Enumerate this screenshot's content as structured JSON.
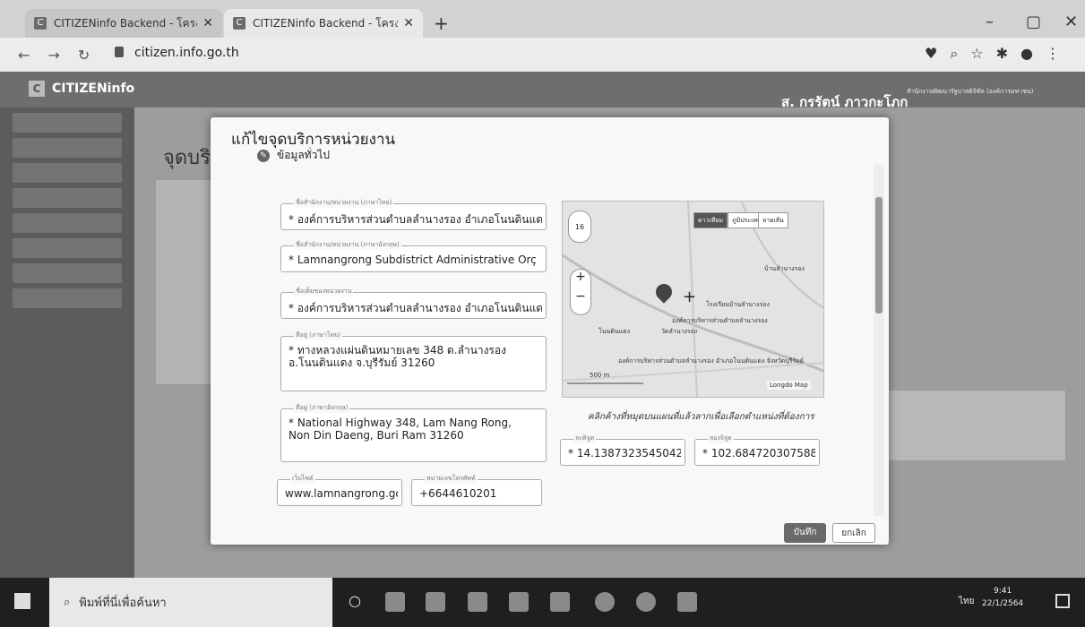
{
  "browser": {
    "tabs": [
      {
        "title": "CITIZENinfo Backend - โครงการฯ"
      },
      {
        "title": "CITIZENinfo Backend - โครงการฯ"
      }
    ],
    "new_tab": "+",
    "url": "citizen.info.go.th",
    "window_controls": [
      "–",
      "▢",
      "✕"
    ]
  },
  "app": {
    "brand": "CITIZENinfo",
    "user_name": "ส. กรรัตน์ ภาวกะโภก",
    "user_sub": "สำนักงานพัฒนารัฐบาลดิจิทัล (องค์การมหาชน)",
    "page_title": "จุดบริ"
  },
  "modal": {
    "title": "แก้ไขจุดบริการหน่วยงาน",
    "section": "ข้อมูลทั่วไป",
    "fields": {
      "name_th": {
        "label": "ชื่อสำนักงาน/หน่วยงาน (ภาษาไทย)",
        "value": "* องค์การบริหารส่วนตำบลลำนางรอง อำเภอโนนดินแด"
      },
      "name_en": {
        "label": "ชื่อสำนักงาน/หน่วยงาน (ภาษาอังกฤษ)",
        "value": "* Lamnangrong Subdistrict Administrative Orç"
      },
      "org_name": {
        "label": "ชื่อเต็มของหน่วยงาน",
        "value": "* องค์การบริหารส่วนตำบลลำนางรอง อำเภอโนนดินแด"
      },
      "address_th": {
        "label": "ที่อยู่ (ภาษาไทย)",
        "value": "* ทางหลวงแผ่นดินหมายเลข 348 ต.ลำนางรอง\n   อ.โนนดินแดง จ.บุรีรัมย์ 31260"
      },
      "address_en": {
        "label": "ที่อยู่ (ภาษาอังกฤษ)",
        "value": "* National Highway 348, Lam Nang Rong,\n   Non Din Daeng, Buri Ram 31260"
      },
      "website": {
        "label": "เว็บไซต์",
        "value": "www.lamnangrong.go"
      },
      "phone": {
        "label": "หมายเลขโทรศัพท์",
        "value": "+6644610201"
      },
      "latitude": {
        "label": "ละติจูด",
        "value": "* 14.1387323545042"
      },
      "longitude": {
        "label": "ลองจิจูด",
        "value": "* 102.6847203075885"
      }
    },
    "map": {
      "buttons": [
        "ดาวเทียม",
        "ภูมิประเทศ",
        "ลายเส้น"
      ],
      "labels": [
        "บ้านลำนางรอง",
        "โรงเรียนบ้านลำนางรอง",
        "องค์การบริหารส่วนตำบลลำนางรอง",
        "โนนดินแดง",
        "วัดลำนางรอง",
        "องค์การบริหารส่วนตำบลลำนางรอง อำเภอโนนดินแดง จังหวัดบุรีรัมย์"
      ],
      "scale": "500 m",
      "attribution": "Longdo Map",
      "zoom_in": "+",
      "zoom_out": "−",
      "zoom_level": "16"
    },
    "map_hint": "คลิกค้างที่หมุดบนแผนที่แล้วลากเพื่อเลือกตำแหน่งที่ต้องการ",
    "save": "บันทึก",
    "cancel": "ยกเลิก"
  },
  "taskbar": {
    "search": "พิมพ์ที่นี่เพื่อค้นหา",
    "time": "9:41",
    "date": "22/1/2564",
    "lang": "ไทย"
  }
}
